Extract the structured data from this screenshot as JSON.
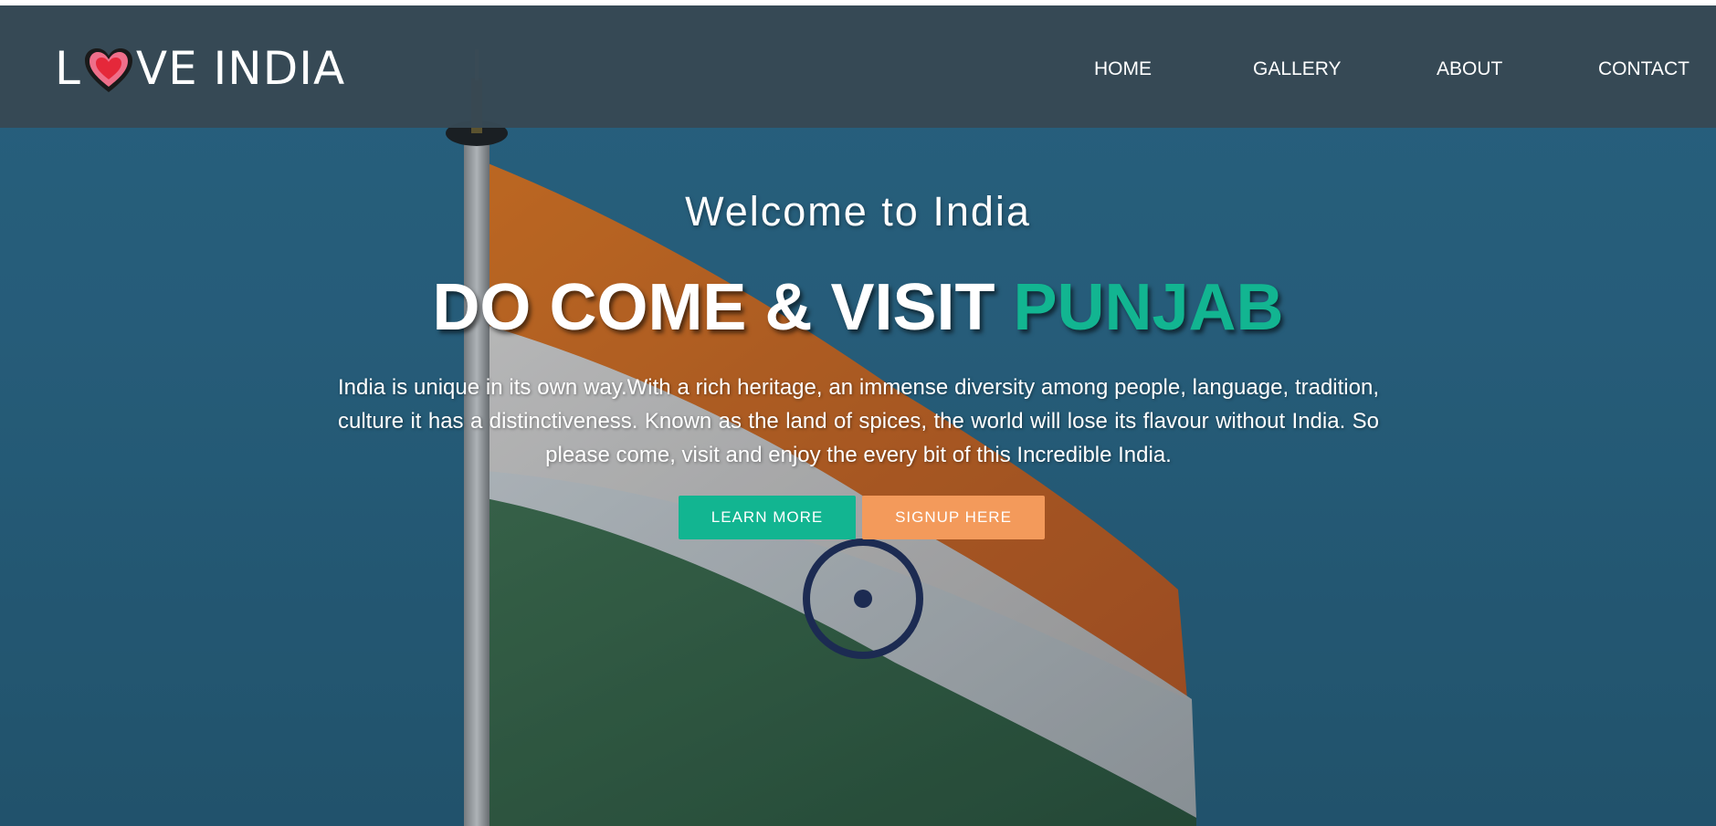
{
  "brand": {
    "logo_text_l": "L",
    "logo_text_rest": "VE INDIA"
  },
  "nav": {
    "items": [
      {
        "label": "HOME"
      },
      {
        "label": "GALLERY"
      },
      {
        "label": "ABOUT"
      },
      {
        "label": "CONTACT"
      }
    ]
  },
  "hero": {
    "welcome": "Welcome to India",
    "headline_main": "DO COME & VISIT ",
    "headline_accent": "PUNJAB",
    "description": "India is unique in its own way.With a rich heritage, an immense diversity among people, language, tradition, culture it has a distinctiveness. Known as the land of spices, the world will lose its flavour without India. So please come, visit and enjoy the every bit of this Incredible India.",
    "learn_more_label": "LEARN MORE",
    "signup_label": "SIGNUP HERE"
  },
  "colors": {
    "accent": "#12b591",
    "signup": "#f39a5b",
    "navbar": "#374854"
  },
  "icons": {
    "logo_heart": "heart-icon",
    "background": "flag-photo"
  }
}
